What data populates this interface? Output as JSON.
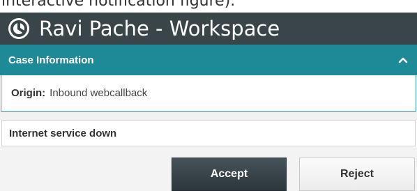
{
  "caption": {
    "text": "interactive notification figure)."
  },
  "window": {
    "icon": "app-logo-icon",
    "title": "Ravi Pache - Workspace"
  },
  "case_section": {
    "title": "Case Information",
    "toggle_icon": "chevron-up-icon",
    "origin_label": "Origin:",
    "origin_value": "Inbound webcallback",
    "subject": "Internet service down"
  },
  "actions": {
    "accept_label": "Accept",
    "reject_label": "Reject"
  },
  "colors": {
    "titlebar": "#3a4549",
    "section_header": "#1f8a97",
    "accept_button": "#2c363b"
  }
}
